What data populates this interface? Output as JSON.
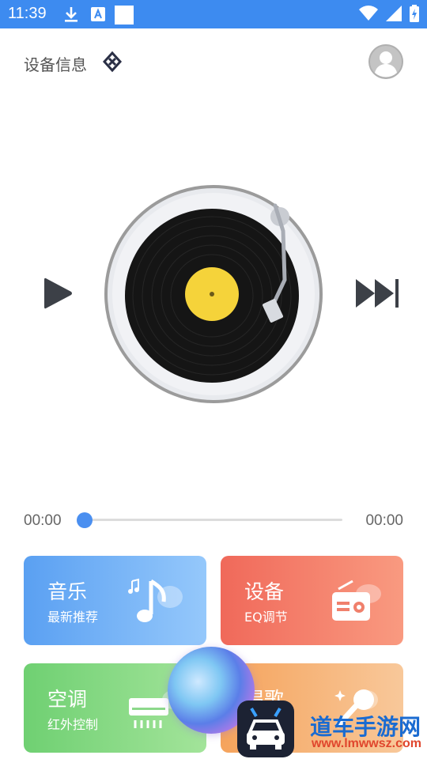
{
  "status_bar": {
    "time": "11:39"
  },
  "header": {
    "title": "设备信息"
  },
  "player": {
    "progress": {
      "current": "00:00",
      "total": "00:00",
      "fraction": 0.0
    }
  },
  "cards": [
    {
      "title": "音乐",
      "subtitle": "最新推荐"
    },
    {
      "title": "设备",
      "subtitle": "EQ调节"
    },
    {
      "title": "空调",
      "subtitle": "红外控制"
    },
    {
      "title": "唱歌",
      "subtitle": ""
    }
  ],
  "watermark": {
    "text": "道车手游网",
    "url": "www.lmwwsz.com"
  },
  "colors": {
    "status_bar": "#3d8bf0",
    "accent": "#4a8ff0",
    "music_card": "#5aa0f2",
    "device_card": "#f0695a",
    "aircon_card": "#6fd072",
    "karaoke_card": "#f5a35c",
    "record_label": "#f5d33a"
  },
  "icons": {
    "header": "diamond-link-icon",
    "avatar": "user-avatar-icon",
    "play": "play-icon",
    "next": "skip-next-icon",
    "music": "music-note-icon",
    "device": "radio-icon",
    "aircon": "air-conditioner-icon",
    "karaoke": "microphone-icon"
  }
}
